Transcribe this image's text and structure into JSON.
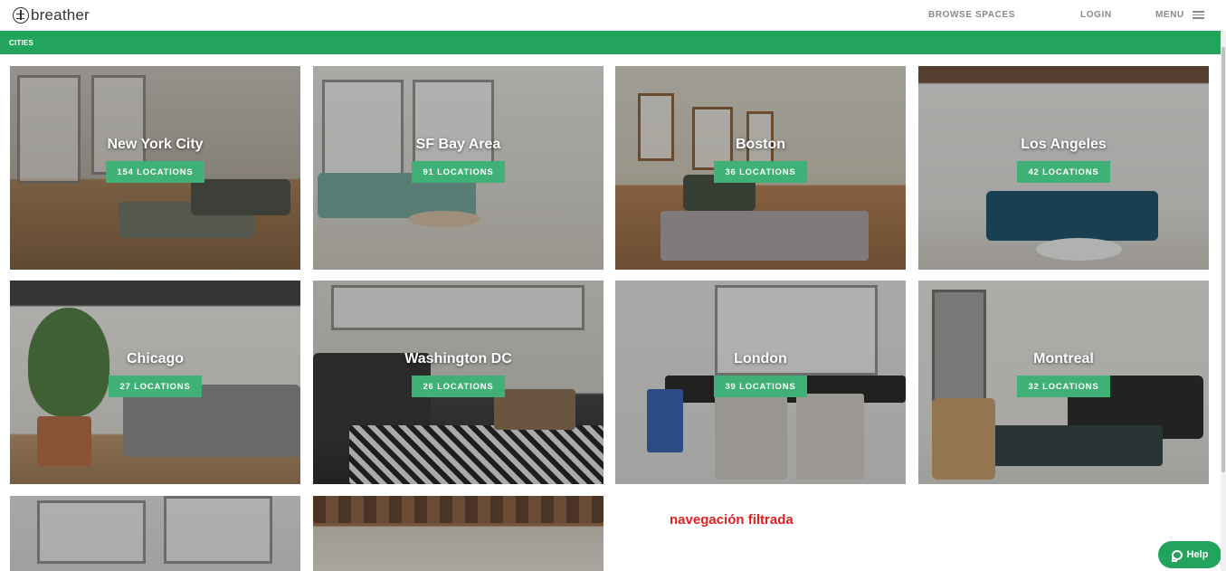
{
  "header": {
    "logo_text": "breather",
    "nav": {
      "browse": "BROWSE SPACES",
      "login": "LOGIN",
      "menu": "MENU"
    }
  },
  "section_label": "CITIES",
  "tiles": [
    {
      "city": "New York City",
      "locations": "154 LOCATIONS"
    },
    {
      "city": "SF Bay Area",
      "locations": "91 LOCATIONS"
    },
    {
      "city": "Boston",
      "locations": "36 LOCATIONS"
    },
    {
      "city": "Los Angeles",
      "locations": "42 LOCATIONS"
    },
    {
      "city": "Chicago",
      "locations": "27 LOCATIONS"
    },
    {
      "city": "Washington DC",
      "locations": "26 LOCATIONS"
    },
    {
      "city": "London",
      "locations": "39 LOCATIONS"
    },
    {
      "city": "Montreal",
      "locations": "32 LOCATIONS"
    }
  ],
  "annotation": "navegación filtrada",
  "help_label": "Help",
  "colors": {
    "brand_green": "#22a45d",
    "badge_green": "#3fb076",
    "annotation_red": "#e02020"
  },
  "icons": [
    "breather-logo-icon",
    "hamburger-icon",
    "chat-bubble-icon"
  ]
}
